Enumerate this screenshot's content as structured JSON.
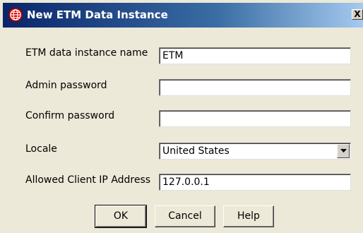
{
  "dialog": {
    "title": "New ETM Data Instance",
    "close_glyph": "X"
  },
  "form": {
    "instance_name": {
      "label": "ETM data instance name",
      "value": "ETM"
    },
    "admin_password": {
      "label": "Admin password",
      "value": ""
    },
    "confirm_password": {
      "label": "Confirm password",
      "value": ""
    },
    "locale": {
      "label": "Locale",
      "value": "United States"
    },
    "client_ip": {
      "label": "Allowed Client IP Address",
      "value": "127.0.0.1"
    }
  },
  "buttons": {
    "ok": "OK",
    "cancel": "Cancel",
    "help": "Help"
  },
  "icons": {
    "app": "globe-icon",
    "dropdown": "chevron-down-icon"
  },
  "colors": {
    "titlebar_start": "#0a246a",
    "titlebar_end": "#a6caf0",
    "dialog_bg": "#ece9d8",
    "app_icon": "#d20000"
  }
}
